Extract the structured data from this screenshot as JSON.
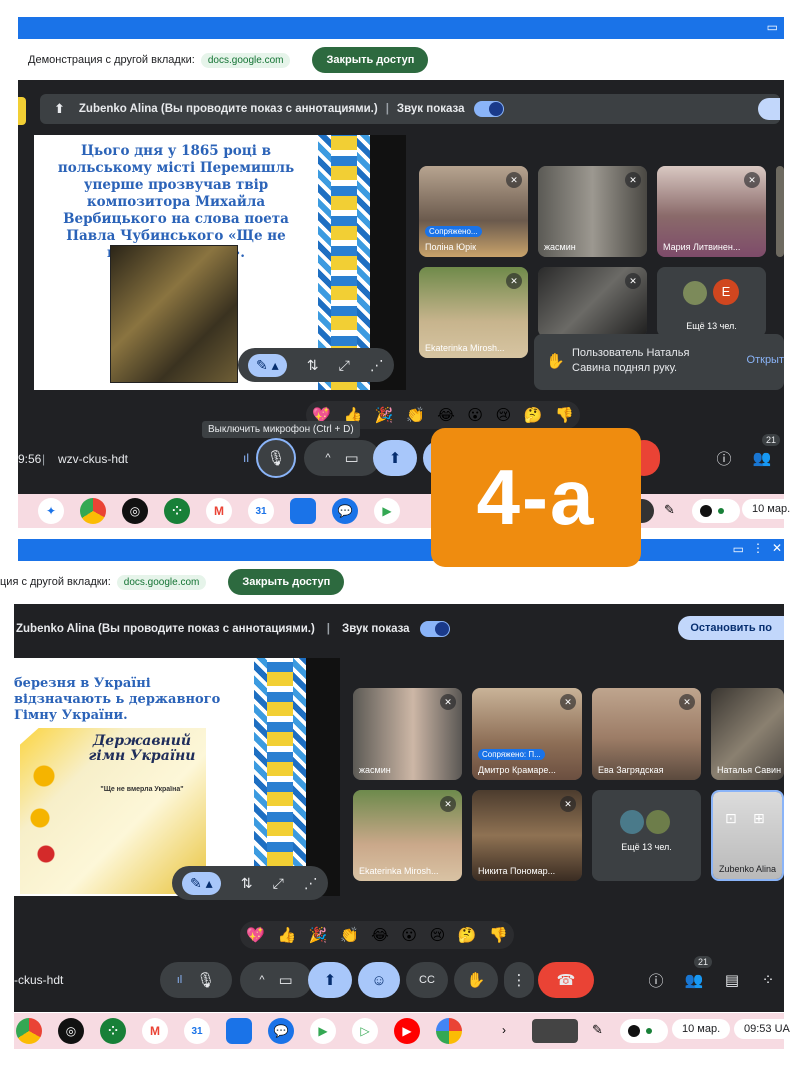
{
  "top": {
    "share_label": "Демонстрация с другой вкладки:",
    "share_domain": "docs.google.com",
    "stop_label": "Закрыть доступ",
    "presenter_text": "Zubenko Alina (Вы проводите показ с аннотациями.)",
    "sound_label": "Звук показа",
    "slide_text": "Цього дня у 1865 році в польському місті Перемишль уперше прозвучав твір композитора Михайла Вербицького на слова поета Павла Чубинського «Ще не вмерла Україна».",
    "tiles": [
      {
        "name": "Поліна Юрік",
        "status": "Сопряжено..."
      },
      {
        "name": "жасмин"
      },
      {
        "name": "Мария Литвинен..."
      },
      {
        "name": "Ekaterinka Mirosh..."
      },
      {
        "name": ""
      },
      {
        "name": "Ещё 13 чел.",
        "avatar": "E"
      }
    ],
    "notification": "Пользователь Наталья Савина поднял руку.",
    "notification_action": "Открыт",
    "tooltip": "Выключить микрофон (Ctrl + D)",
    "time": "9:56",
    "meeting_code": "wzv-ckus-hdt",
    "participants_count": "21",
    "shelf_date": "10 мар."
  },
  "badge": "4-а",
  "bottom": {
    "share_label": "ция с другой вкладки:",
    "share_domain": "docs.google.com",
    "stop_label": "Закрыть доступ",
    "presenter_text": "Zubenko Alina (Вы проводите показ с аннотациями.)",
    "sound_label": "Звук показа",
    "stop_pres_label": "Остановить по",
    "slide_text": "березня в Україні відзначають ь державного Гімну України.",
    "anthem_title": "Державний гімн України",
    "anthem_sub": "\"Ще не вмерла Україна\"",
    "tiles": [
      {
        "name": "жасмин"
      },
      {
        "name": "Дмитро Крамаре...",
        "status": "Сопряжено: П..."
      },
      {
        "name": "Ева Загрядская"
      },
      {
        "name": "Наталья Савин"
      },
      {
        "name": "Ekaterinka Mirosh..."
      },
      {
        "name": "Никита Пономар..."
      },
      {
        "name": "Ещё 13 чел."
      },
      {
        "name": "Zubenko Alina"
      }
    ],
    "meeting_code": "-ckus-hdt",
    "participants_count": "21",
    "shelf_date": "10 мар.",
    "shelf_time": "09:53",
    "shelf_locale": "UA"
  },
  "reactions": [
    "💖",
    "👍",
    "🎉",
    "👏",
    "😂",
    "😮",
    "😢",
    "🤔",
    "👎"
  ],
  "colors": {
    "meet_bg": "#202124",
    "accent_blue": "#1a73e8",
    "end_call": "#ea4335",
    "badge": "#ef8c0f"
  }
}
